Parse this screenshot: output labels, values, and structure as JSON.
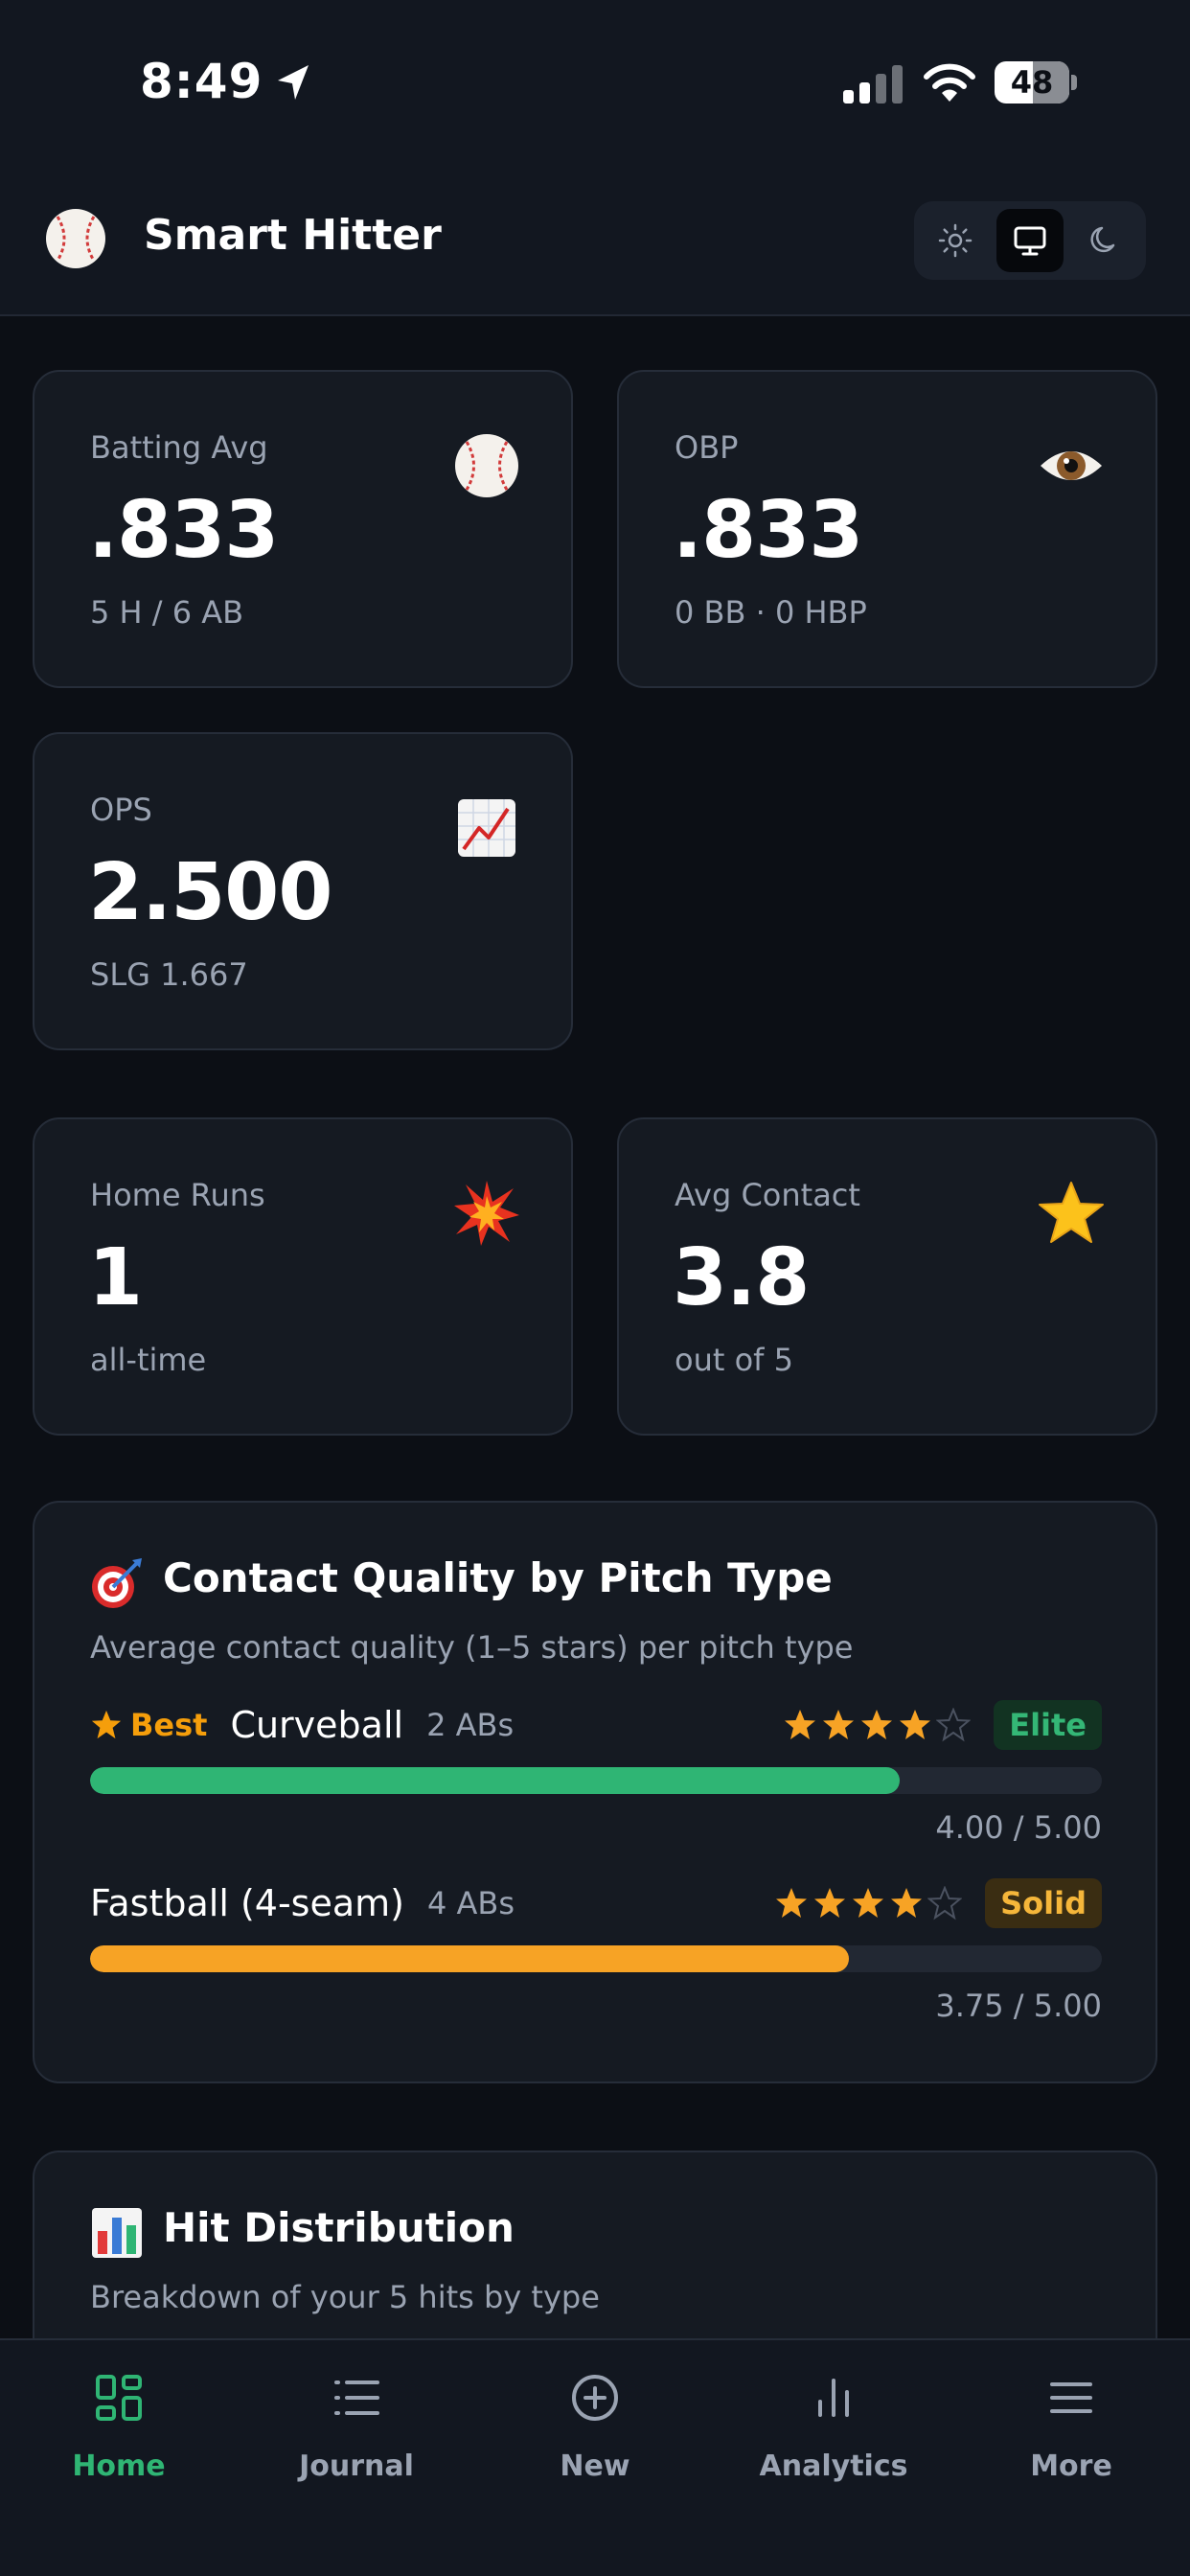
{
  "status_bar": {
    "time": "8:49",
    "battery": "48"
  },
  "header": {
    "title": "Smart Hitter"
  },
  "stats": {
    "batting_avg": {
      "label": "Batting Avg",
      "value": ".833",
      "sub": "5 H / 6 AB",
      "icon": "baseball-icon"
    },
    "obp": {
      "label": "OBP",
      "value": ".833",
      "sub": "0 BB · 0 HBP",
      "icon": "eye-icon"
    },
    "ops": {
      "label": "OPS",
      "value": "2.500",
      "sub": "SLG 1.667",
      "icon": "chart-up-icon"
    },
    "home_runs": {
      "label": "Home Runs",
      "value": "1",
      "sub": "all-time",
      "icon": "explosion-icon"
    },
    "avg_contact": {
      "label": "Avg Contact",
      "value": "3.8",
      "sub": "out of 5",
      "icon": "star-icon"
    }
  },
  "contact_quality": {
    "title": "Contact Quality by Pitch Type",
    "subtitle": "Average contact quality (1–5 stars) per pitch type",
    "best_label": "Best",
    "rows": [
      {
        "pitch": "Curveball",
        "abs": "2 ABs",
        "stars": 4,
        "grade": "Elite",
        "score": "4.00 / 5.00",
        "fraction": 0.8
      },
      {
        "pitch": "Fastball (4-seam)",
        "abs": "4 ABs",
        "stars": 4,
        "grade": "Solid",
        "score": "3.75 / 5.00",
        "fraction": 0.75
      }
    ]
  },
  "hit_distribution": {
    "title": "Hit Distribution",
    "subtitle": "Breakdown of your 5 hits by type"
  },
  "nav": {
    "items": [
      {
        "label": "Home",
        "icon": "grid-icon",
        "active": true
      },
      {
        "label": "Journal",
        "icon": "list-icon",
        "active": false
      },
      {
        "label": "New",
        "icon": "plus-circle-icon",
        "active": false
      },
      {
        "label": "Analytics",
        "icon": "bar-chart-icon",
        "active": false
      },
      {
        "label": "More",
        "icon": "menu-icon",
        "active": false
      }
    ]
  },
  "colors": {
    "accent": "#2fb574",
    "warning": "#f7a325",
    "background": "#0c0f15"
  }
}
